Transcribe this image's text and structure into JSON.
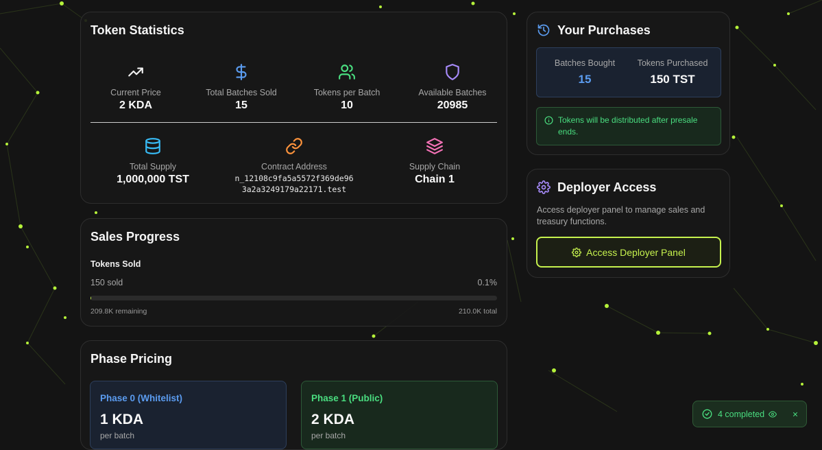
{
  "token_statistics": {
    "title": "Token Statistics",
    "stats": [
      {
        "label": "Current Price",
        "value": "2 KDA"
      },
      {
        "label": "Total Batches Sold",
        "value": "15"
      },
      {
        "label": "Tokens per Batch",
        "value": "10"
      },
      {
        "label": "Available Batches",
        "value": "20985"
      },
      {
        "label": "Total Supply",
        "value": "1,000,000 TST"
      },
      {
        "label": "Contract Address",
        "value_line1": "n_12108c9fa5a5572f369de96",
        "value_line2": "3a2a3249179a22171.test"
      },
      {
        "label": "Supply Chain",
        "value": "Chain 1"
      }
    ]
  },
  "sales_progress": {
    "title": "Sales Progress",
    "subtitle": "Tokens Sold",
    "sold_text": "150 sold",
    "percent_text": "0.1%",
    "progress_fraction": 0.001,
    "remaining_text": "209.8K remaining",
    "total_text": "210.0K total"
  },
  "phase_pricing": {
    "title": "Phase Pricing",
    "phases": [
      {
        "name": "Phase 0 (Whitelist)",
        "price": "1 KDA",
        "unit": "per batch"
      },
      {
        "name": "Phase 1 (Public)",
        "price": "2 KDA",
        "unit": "per batch"
      }
    ]
  },
  "your_purchases": {
    "title": "Your Purchases",
    "batches_label": "Batches Bought",
    "batches_value": "15",
    "tokens_label": "Tokens Purchased",
    "tokens_value": "150 TST",
    "notice_line1": "Tokens will be distributed after presale",
    "notice_line2": "ends."
  },
  "deployer_access": {
    "title": "Deployer Access",
    "desc_line1": "Access deployer panel to manage sales and",
    "desc_line2": "treasury functions.",
    "button_label": "Access Deployer Panel"
  },
  "toast": {
    "label": "4 completed"
  },
  "colors": {
    "accent_lime": "#c6f24e",
    "blue": "#5b9cf0",
    "green": "#4ade80",
    "cyan": "#38bdf8",
    "orange": "#fb923c",
    "pink": "#f472b6",
    "purple": "#a78bfa"
  }
}
